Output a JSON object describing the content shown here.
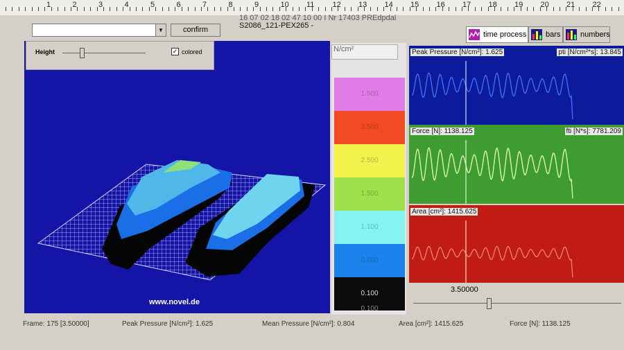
{
  "ruler": {
    "numbers": [
      "1",
      "2",
      "3",
      "4",
      "5",
      "6",
      "7",
      "8",
      "9",
      "10",
      "11",
      "12",
      "13",
      "14",
      "15",
      "16",
      "17",
      "18",
      "19",
      "20",
      "21",
      "22"
    ]
  },
  "toolbar": {
    "confirm_label": "confirm"
  },
  "file_info": {
    "line1": "16 07 02 18 02 47  10 00 I  Nr 17403 PREdpdal",
    "line2": "S2086_121-PEX265 -"
  },
  "tabs": [
    {
      "label": "time process"
    },
    {
      "label": "bars"
    },
    {
      "label": "numbers"
    }
  ],
  "control": {
    "height_label": "Height",
    "colored_label": "colored",
    "colored_checked": true
  },
  "plot": {
    "watermark": "www.novel.de"
  },
  "legend": {
    "unit": "N/cm²",
    "bands": [
      {
        "color": "#e07de6",
        "label": "1.500"
      },
      {
        "color": "#f24a22",
        "label": "3.500"
      },
      {
        "color": "#f3f14c",
        "label": "2.500"
      },
      {
        "color": "#9fe04d",
        "label": "1.500"
      },
      {
        "color": "#84f4f2",
        "label": "1.100"
      },
      {
        "color": "#1a84ec",
        "label": "0.600"
      },
      {
        "color": "#0b0b0b",
        "label": "0.100"
      }
    ],
    "bottom_label": "0.100"
  },
  "graphs": [
    {
      "label_left": "Peak Pressure [N/cm²]: 1.625",
      "label_right": "pti [N/cm²*s]: 13.845",
      "bg": "#0c1a9c",
      "line": "#3d6dff"
    },
    {
      "label_left": "Force [N]: 1138.125",
      "label_right": "fti [N*s]: 7781.209",
      "bg": "#3e9c30",
      "line": "#d9f7b0"
    },
    {
      "label_left": "Area [cm²]: 1415.625",
      "label_right": "",
      "bg": "#c01c14",
      "line": "#f28060"
    }
  ],
  "time_cursor": "3.50000",
  "status": {
    "frame": "Frame: 175 [3.50000]",
    "peak": "Peak Pressure [N/cm²]: 1.625",
    "mean": "Mean Pressure [N/cm²]: 0.804",
    "area": "Area [cm²]: 1415.625",
    "force": "Force [N]: 1138.125"
  }
}
